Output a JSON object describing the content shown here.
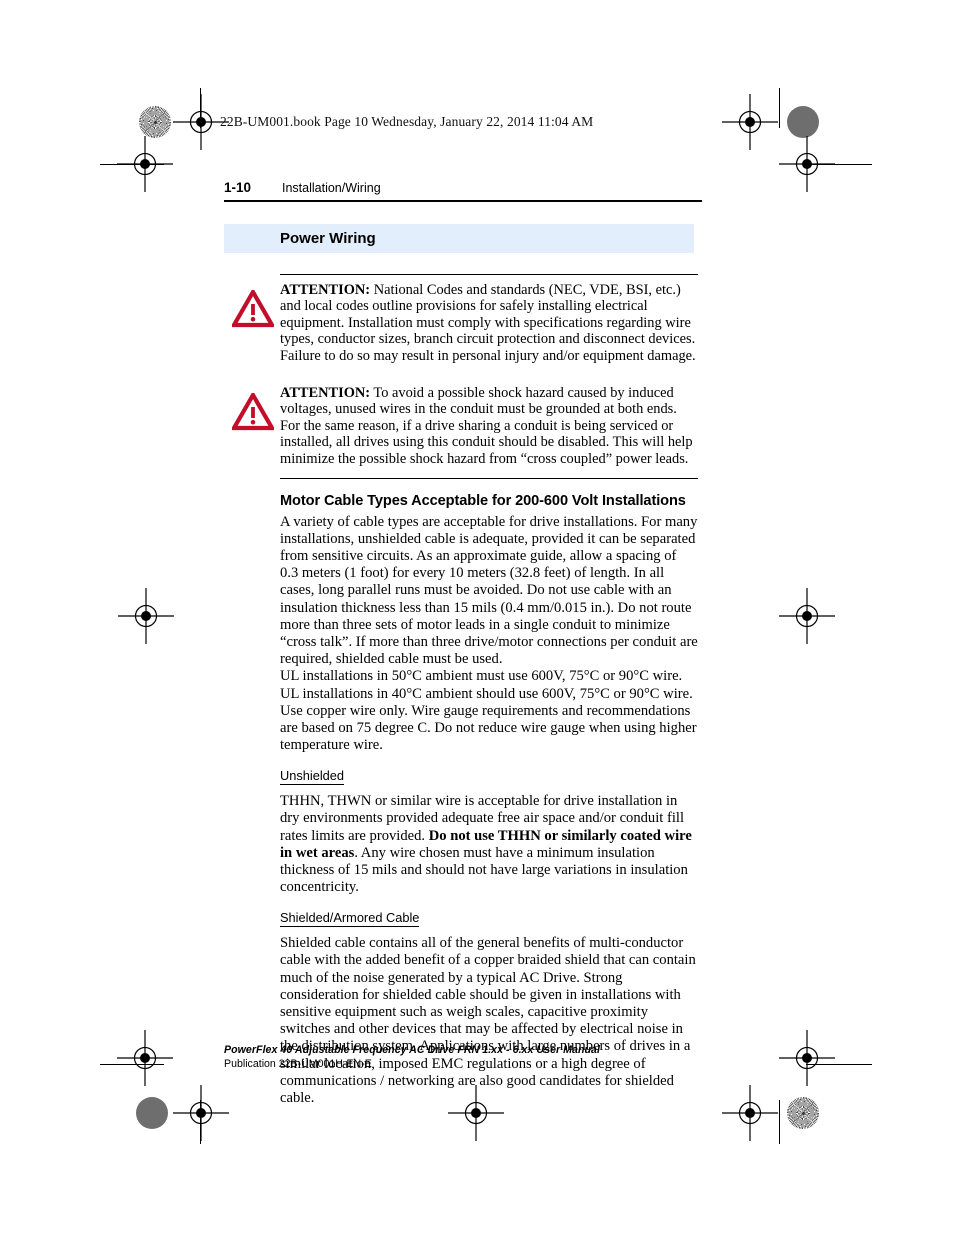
{
  "file_info": "22B-UM001.book  Page 10  Wednesday, January 22, 2014  11:04 AM",
  "running_head": {
    "page_number": "1-10",
    "chapter_title": "Installation/Wiring"
  },
  "section": {
    "title": "Power Wiring",
    "band_color": "#e2eefb"
  },
  "attentions": [
    {
      "icon": "warning-triangle-icon",
      "label": "ATTENTION:",
      "text": " National Codes and standards (NEC, VDE, BSI, etc.) and local codes outline provisions for safely installing electrical equipment. Installation must comply with specifications regarding wire types, conductor sizes, branch circuit protection and disconnect devices. Failure to do so may result in personal injury and/or equipment damage.",
      "color": "#c20e2a"
    },
    {
      "icon": "warning-triangle-icon",
      "label": "ATTENTION:",
      "text": "  To avoid a possible shock hazard caused by induced voltages, unused wires in the conduit must be grounded at both ends. For the same reason, if a drive sharing a conduit is being serviced or installed, all drives using this conduit should be disabled. This will help minimize the possible shock hazard from “cross coupled” power leads.",
      "color": "#c20e2a"
    }
  ],
  "main": {
    "heading": "Motor Cable Types Acceptable for 200-600 Volt Installations",
    "paragraph_1": "A variety of cable types are acceptable for drive installations. For many installations, unshielded cable is adequate, provided it can be separated from sensitive circuits. As an approximate guide, allow a spacing of 0.3 meters (1 foot) for every 10 meters (32.8 feet) of length. In all cases, long parallel runs must be avoided. Do not use cable with an insulation thickness less than 15 mils (0.4 mm/0.015 in.). Do not route more than three sets of motor leads in a single conduit to minimize “cross talk”. If more than three drive/motor connections per conduit are required, shielded cable must be used.",
    "paragraph_2": "UL installations in 50°C ambient must use 600V, 75°C or 90°C wire. UL installations in 40°C ambient should use 600V, 75°C or 90°C wire. Use copper wire only. Wire gauge requirements and recommendations are based on 75 degree C. Do not reduce wire gauge when using higher temperature wire.",
    "subsections": [
      {
        "heading": "Unshielded",
        "text_before_bold": "THHN, THWN or similar wire is acceptable for drive installation in dry environments provided adequate free air space and/or conduit fill rates limits are provided. ",
        "bold_text": "Do not use THHN or similarly coated wire in wet areas",
        "text_after_bold": ". Any wire chosen must have a minimum insulation thickness of 15 mils and should not have large variations in insulation concentricity."
      },
      {
        "heading": "Shielded/Armored Cable",
        "text_before_bold": "Shielded cable contains all of the general benefits of multi-conductor cable with the added benefit of a copper braided shield that can contain much of the noise generated by a typical AC Drive. Strong consideration for shielded cable should be given in installations with sensitive equipment such as weigh scales, capacitive proximity switches and other devices that may be affected by electrical noise in the distribution system. Applications with large numbers of drives in a similar location, imposed EMC regulations or a high degree of communications / networking are also good candidates for shielded cable.",
        "bold_text": "",
        "text_after_bold": ""
      }
    ]
  },
  "footer": {
    "line1": "PowerFlex 40 Adjustable Frequency AC Drive FRN 1.xx - 6.xx User Manual",
    "line2": "Publication 22B-UM001H-EN-E"
  }
}
